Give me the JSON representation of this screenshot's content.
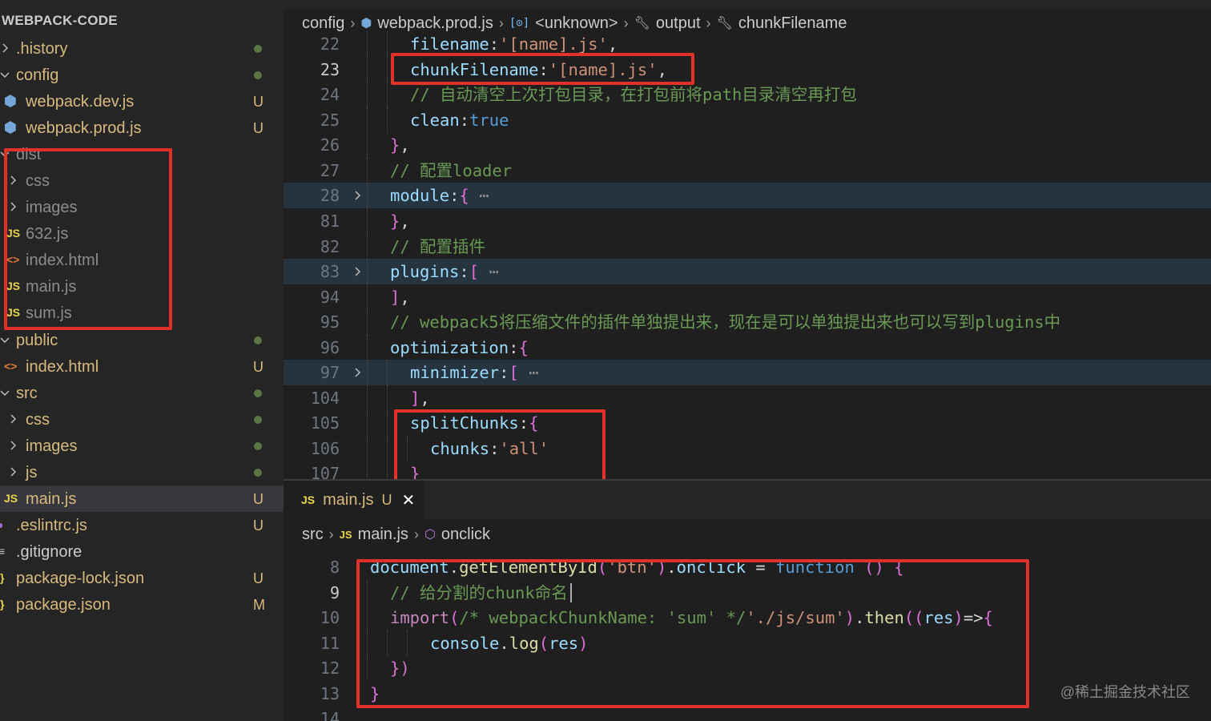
{
  "explorer": {
    "title": "WEBPACK-CODE",
    "items": [
      {
        "label": ".history",
        "status": "dot",
        "color": "#d7ba7d"
      },
      {
        "label": "config",
        "status": "dot",
        "color": "#d7ba7d"
      },
      {
        "label": "webpack.dev.js",
        "status": "U",
        "color": "#d7ba7d",
        "icon": "⬢"
      },
      {
        "label": "webpack.prod.js",
        "status": "U",
        "color": "#d7ba7d",
        "icon": "⬢"
      },
      {
        "label": "dist",
        "status": "",
        "color": "#8c8c8c"
      },
      {
        "label": "css",
        "status": "",
        "color": "#8c8c8c"
      },
      {
        "label": "images",
        "status": "",
        "color": "#8c8c8c"
      },
      {
        "label": "632.js",
        "status": "",
        "color": "#8c8c8c",
        "icon": "JS"
      },
      {
        "label": "index.html",
        "status": "",
        "color": "#8c8c8c",
        "icon": "<>"
      },
      {
        "label": "main.js",
        "status": "",
        "color": "#8c8c8c",
        "icon": "JS"
      },
      {
        "label": "sum.js",
        "status": "",
        "color": "#8c8c8c",
        "icon": "JS"
      },
      {
        "label": "public",
        "status": "dot",
        "color": "#d7ba7d"
      },
      {
        "label": "index.html",
        "status": "U",
        "color": "#d7ba7d",
        "icon": "<>"
      },
      {
        "label": "src",
        "status": "dot",
        "color": "#d7ba7d"
      },
      {
        "label": "css",
        "status": "dot",
        "color": "#d7ba7d"
      },
      {
        "label": "images",
        "status": "dot",
        "color": "#d7ba7d"
      },
      {
        "label": "js",
        "status": "dot",
        "color": "#d7ba7d"
      },
      {
        "label": "main.js",
        "status": "U",
        "color": "#d7ba7d",
        "icon": "JS"
      },
      {
        "label": ".eslintrc.js",
        "status": "U",
        "color": "#d7ba7d",
        "icon": "●"
      },
      {
        "label": ".gitignore",
        "status": "",
        "color": "#cccccc",
        "icon": "≡"
      },
      {
        "label": "package-lock.json",
        "status": "U",
        "color": "#d7ba7d",
        "icon": "}"
      },
      {
        "label": "package.json",
        "status": "M",
        "color": "#d7ba7d",
        "icon": "}"
      }
    ]
  },
  "top_breadcrumb": {
    "parts": [
      "config",
      "webpack.prod.js",
      "<unknown>",
      "output",
      "chunkFilename"
    ]
  },
  "top_editor": {
    "lines": [
      {
        "num": "22",
        "text": "filename:'[name].js',"
      },
      {
        "num": "23",
        "text": "chunkFilename:'[name].js',"
      },
      {
        "num": "24",
        "text": "// 自动清空上次打包目录，在打包前将path目录清空再打包"
      },
      {
        "num": "25",
        "text": "clean:true"
      },
      {
        "num": "26",
        "text": "},"
      },
      {
        "num": "27",
        "text": "// 配置loader"
      },
      {
        "num": "28",
        "text": "module:{"
      },
      {
        "num": "81",
        "text": "},"
      },
      {
        "num": "82",
        "text": "// 配置插件"
      },
      {
        "num": "83",
        "text": "plugins:["
      },
      {
        "num": "94",
        "text": "],"
      },
      {
        "num": "95",
        "text": "// webpack5将压缩文件的插件单独提出来，现在是可以单独提出来也可以写到plugins中"
      },
      {
        "num": "96",
        "text": "optimization:{"
      },
      {
        "num": "97",
        "text": "minimizer:["
      },
      {
        "num": "104",
        "text": "],"
      },
      {
        "num": "105",
        "text": "splitChunks:{"
      },
      {
        "num": "106",
        "text": "chunks:'all'"
      },
      {
        "num": "107",
        "text": "}"
      }
    ]
  },
  "bottom_tab": {
    "icon": "JS",
    "label": "main.js",
    "status": "U",
    "close": "✕"
  },
  "bottom_breadcrumb": {
    "parts": [
      "src",
      "main.js",
      "onclick"
    ]
  },
  "bottom_editor": {
    "lines": [
      {
        "num": "8",
        "text": "document.getElementById('btn').onclick = function () {"
      },
      {
        "num": "9",
        "text": "// 给分割的chunk命名"
      },
      {
        "num": "10",
        "text": "import(/* webpackChunkName: 'sum' */'./js/sum').then((res)=>{"
      },
      {
        "num": "11",
        "text": "console.log(res)"
      },
      {
        "num": "12",
        "text": "})"
      },
      {
        "num": "13",
        "text": "}"
      },
      {
        "num": "14",
        "text": ""
      }
    ]
  },
  "watermark": "@稀土掘金技术社区",
  "colors": {
    "red_highlight": "#e0312b",
    "keyword_blue": "#569cd6",
    "string_orange": "#ce9178",
    "property_lightblue": "#9cdcfe",
    "comment_gray": "#6a9955",
    "function_yellow": "#dcdcaa",
    "explorer_modified": "#d7ba7d"
  }
}
